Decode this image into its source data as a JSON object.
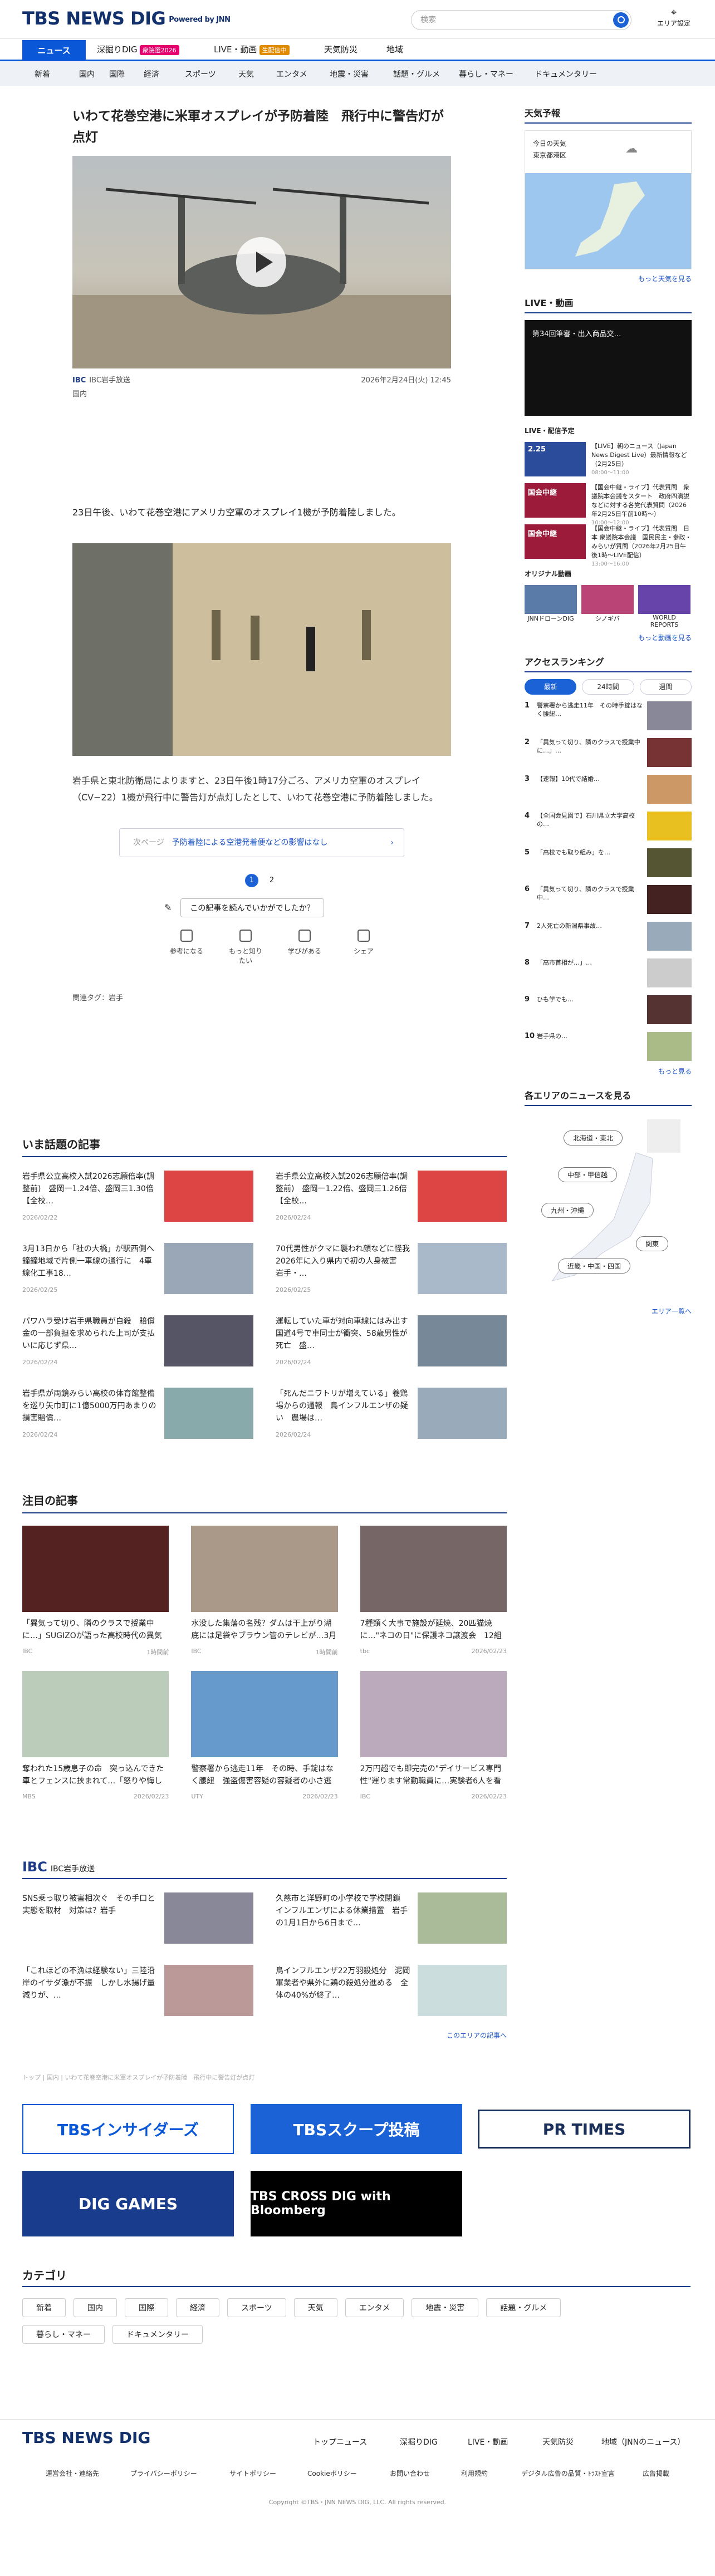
{
  "header": {
    "logo": "TBS NEWS DIG",
    "powered": "Powered by JNN",
    "search_placeholder": "検索",
    "area_label": "エリア設定"
  },
  "nav1": [
    {
      "label": "ニュース"
    },
    {
      "label": "深掘りDIG",
      "badge": "衆院選2026",
      "badge_color": "#e5006e"
    },
    {
      "label": "LIVE・動画",
      "badge": "生配信中",
      "badge_color": "#e08a00"
    },
    {
      "label": "天気防災"
    },
    {
      "label": "地域"
    }
  ],
  "nav2": [
    "新着",
    "国内",
    "国際",
    "経済",
    "スポーツ",
    "天気",
    "エンタメ",
    "地震・災害",
    "話題・グルメ",
    "暮らし・マネー",
    "ドキュメンタリー"
  ],
  "article": {
    "title": "いわて花巻空港に米軍オスプレイが予防着陸　飛行中に警告灯が点灯",
    "source": "IBC岩手放送",
    "date": "2026年2月24日(火) 12:45",
    "category": "国内",
    "para1": "23日午後、いわて花巻空港にアメリカ空軍のオスプレイ1機が予防着陸しました。",
    "para2": "岩手県と東北防衛局によりますと、23日午後1時17分ごろ、アメリカ空軍のオスプレイ（CV−22）1機が飛行中に警告灯が点灯したとして、いわて花巻空港に予防着陸しました。",
    "next_prefix": "次ページ",
    "next_text": "予防着陸による空港発着便などの影響はなし",
    "pages": [
      "1",
      "2"
    ],
    "survey_q": "この記事を読んでいかがでしたか？",
    "reactions": [
      "参考になる",
      "もっと知りたい",
      "学びがある",
      "シェア"
    ],
    "tags": "関連タグ：岩手"
  },
  "trending": {
    "title": "いま話題の記事",
    "items": [
      {
        "t": "岩手県公立高校入試2026志願倍率(調整前)　盛岡一1.24倍、盛岡三1.30倍【全校…",
        "d": "2026/02/22"
      },
      {
        "t": "岩手県公立高校入試2026志願倍率(調整前)　盛岡一1.22倍、盛岡三1.26倍【全校…",
        "d": "2026/02/24"
      },
      {
        "t": "3月13日から「社の大橋」が駅西側へ鐘鐘地域で片側一車線の通行に　4車線化工事18…",
        "d": "2026/02/25"
      },
      {
        "t": "70代男性がクマに襲われ顔などに怪我　2026年に入り県内で初の人身被害　岩手・…",
        "d": "2026/02/25"
      },
      {
        "t": "パワハラ受け岩手県職員が自殺　賠償金の一部負担を求められた上司が支払いに応じず県…",
        "d": "2026/02/24"
      },
      {
        "t": "運転していた車が対向車線にはみ出す　国道4号で車同士が衝突、58歳男性が死亡　盛…",
        "d": "2026/02/24"
      },
      {
        "t": "岩手県が両鏡みらい高校の体育館整備を巡り矢巾町に1億5000万円あまりの損害賠償…",
        "d": "2026/02/24"
      },
      {
        "t": "「死んだニワトリが増えている」養鶏場からの通報　鳥インフルエンザの疑い　農場は…",
        "d": "2026/02/24"
      }
    ]
  },
  "featured": {
    "title": "注目の記事",
    "items": [
      {
        "t": "「異気って切り、隣のクラスで授業中に…」SUGIZOが語った高校時代の異気さんとの思い出　醜病中だ…",
        "src": "IBC",
        "d": "1時間前"
      },
      {
        "t": "水没した集落の名残？ダムは干上がり湖底には足袋やブラウン管のテレビが…3月中旬にも貯水率0%に…",
        "src": "IBC",
        "d": "1時間前"
      },
      {
        "t": "7種類く大事で施設が延焼、20匹猫焼に…\"ネコの日\"に保護ネコ譲渡会　12組が里親も見つ「ゆっく…",
        "src": "tbc",
        "d": "2026/02/23"
      },
      {
        "t": "奪われた15歳息子の命　突っ込んできた車とフェンスに挟まれて…「怒りや悔しさや悲しみ…生忘れな…",
        "src": "MBS",
        "d": "2026/02/23"
      },
      {
        "t": "警察署から逃走11年　その時、手錠はなく腰紐　強盗傷害容疑の容疑者の小さ逃走が…警察逃走事件振…",
        "src": "UTY",
        "d": "2026/02/23"
      },
      {
        "t": "2万円超でも即完売の\"デイサービス専門性\"運ります常勤職員に…実験者6人を看護師や理学療法士など4…",
        "src": "IBC",
        "d": "2026/02/23"
      }
    ]
  },
  "ibc": {
    "label": "IBC岩手放送",
    "items": [
      {
        "t": "SNS乗っ取り被害相次ぐ　その手口と実態を取材　対策は？岩手"
      },
      {
        "t": "久慈市と洋野町の小学校で学校閉鎖　インフルエンザによる休業措置　岩手の1月1日から6日まで…"
      },
      {
        "t": "「これほどの不漁は経験ない」三陸沿岸のイサダ漁が不振　しかし水揚げ量減りが、…"
      },
      {
        "t": "鳥インフルエンザ22万羽殺処分　泥岡軍業者や県外に鶏の殺処分進める　全体の40%が終了…"
      }
    ],
    "more": "このエリアの記事へ"
  },
  "notice": "トップ | 国内 | いわて花巻空港に米軍オスプレイが予防着陸　飛行中に警告灯が点灯",
  "banners": [
    "TBSインサイダーズ",
    "TBSスクープ投稿",
    "PR TIMES",
    "DIG GAMES",
    "TBS CROSS DIG with Bloomberg"
  ],
  "categories": {
    "title": "カテゴリ",
    "items": [
      "新着",
      "国内",
      "国際",
      "経済",
      "スポーツ",
      "天気",
      "エンタメ",
      "地震・災害",
      "話題・グルメ",
      "暮らし・マネー",
      "ドキュメンタリー"
    ]
  },
  "sidebar": {
    "weather_title": "天気予報",
    "weather_today": "今日の天気",
    "weather_place": "東京都港区",
    "weather_more": "もっと天気を見る",
    "live_title": "LIVE・動画",
    "live_video": "第34回筆審・出入商品交…",
    "live_sched": "LIVE・配信予定",
    "live_items": [
      {
        "thumb": "2.25",
        "t": "【LIVE】朝のニュース（Japan News Digest Live）最新情報など（2月25日）",
        "time": "08:00～11:00"
      },
      {
        "thumb": "国会中継",
        "t": "【国会中継・ライブ】代表質問　衆議院本会議をスタート　政府四演説などに対する各党代表質問（2026年2月25日午前10時～）",
        "time": "10:00～12:00"
      },
      {
        "thumb": "国会中継",
        "t": "【国会中継・ライブ】代表質問　日本 衆議院本会議　国民民主・参政・みらいが質問（2026年2月25日午後1時～LIVE配信）",
        "time": "13:00～16:00"
      }
    ],
    "orig_title": "オリジナル動画",
    "orig": [
      "JNNドローンDIG",
      "シノギバ",
      "WORLD REPORTS"
    ],
    "video_more": "もっと動画を見る",
    "ranking_title": "アクセスランキング",
    "rank_tabs": [
      "最新",
      "24時間",
      "週間"
    ],
    "ranks": [
      "警察署から逃走11年　その時手錠はなく腰紐…",
      "「異気って切り、隣のクラスで授業中に…」…",
      "【速報】10代で結婚…",
      "【全国会見図で】石川県立大学高校の…",
      "「高校でも取り組み」を…",
      "「異気って切り、隣のクラスで授業中…",
      "2人死亡の新潟県事故…",
      "「高市首相が…」…",
      "ひも学でも…",
      "岩手県の…"
    ],
    "rank_more": "もっと見る",
    "area_title": "各エリアのニュースを見る",
    "areas": [
      "北海道・東北",
      "中部・甲信越",
      "九州・沖縄",
      "関東",
      "近畿・中国・四国"
    ],
    "area_more": "エリア一覧へ"
  },
  "footer": {
    "logo": "TBS NEWS DIG",
    "nav": [
      "トップニュース",
      "深掘りDIG",
      "LIVE・動画",
      "天気防災",
      "地域（JNNのニュース）"
    ],
    "links": [
      "運営会社・連絡先",
      "プライバシーポリシー",
      "サイトポリシー",
      "Cookieポリシー",
      "お問い合わせ",
      "利用規約",
      "デジタル広告の品質・ﾄﾗｽﾄ宣言",
      "広告掲載"
    ],
    "copyright": "Copyright ©TBS・JNN NEWS DIG, LLC. All rights reserved."
  },
  "colors": {
    "brand": "#12306b",
    "accent": "#0a58d8"
  }
}
